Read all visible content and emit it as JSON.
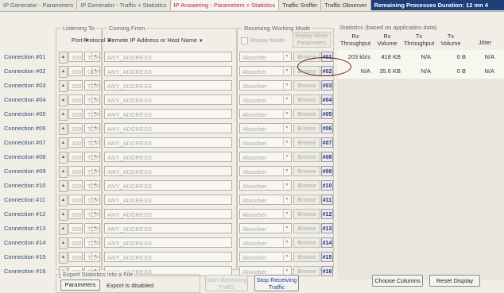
{
  "tabs": [
    {
      "label": "IP Generator - Parameters",
      "state": "normal"
    },
    {
      "label": "IP Generator - Traffic + Statistics",
      "state": "normal"
    },
    {
      "label": "IP Answering - Parameters + Statistics",
      "state": "active"
    },
    {
      "label": "Traffic Sniffer",
      "state": "plain"
    },
    {
      "label": "Traffic Observer",
      "state": "plain"
    }
  ],
  "remaining": "Remaining Processes Duration: 12 mn 4",
  "groups": {
    "listening": "Listening To",
    "coming_from": "Coming From",
    "receiving_mode": "Receiving Working Mode",
    "statistics": "Statistics (based on application data)",
    "export": "Export Statistics into a File"
  },
  "headers": {
    "port": "Port",
    "protocol": "Protocol",
    "remote": "Remote IP Address or Host Name",
    "replay_mode": "Replay Mode",
    "replay_params": [
      "Replay Mode",
      "Parameters"
    ],
    "rx_throughput": [
      "Rx",
      "Throughput"
    ],
    "rx_volume": [
      "Rx",
      "Volume"
    ],
    "tx_throughput": [
      "Tx",
      "Throughput"
    ],
    "tx_volume": [
      "Tx",
      "Volume"
    ],
    "jitter": "Jitter"
  },
  "connections": [
    {
      "label": "Connection #01",
      "port": "2009",
      "protocol": "TCP",
      "remote": "ANY_ADDRESS",
      "mode": "Absorber",
      "browse": "Browse",
      "num": "#01"
    },
    {
      "label": "Connection #02",
      "port": "2009",
      "protocol": "UDP",
      "remote": "ANY_ADDRESS",
      "mode": "Absorber",
      "browse": "Browse",
      "num": "#02"
    },
    {
      "label": "Connection #03",
      "port": "2009",
      "protocol": "TCP",
      "remote": "ANY_ADDRESS",
      "mode": "Absorber",
      "browse": "Browse",
      "num": "#03"
    },
    {
      "label": "Connection #04",
      "port": "2009",
      "protocol": "TCP",
      "remote": "ANY_ADDRESS",
      "mode": "Absorber",
      "browse": "Browse",
      "num": "#04"
    },
    {
      "label": "Connection #05",
      "port": "2009",
      "protocol": "TCP",
      "remote": "ANY_ADDRESS",
      "mode": "Absorber",
      "browse": "Browse",
      "num": "#05"
    },
    {
      "label": "Connection #06",
      "port": "2009",
      "protocol": "TCP",
      "remote": "ANY_ADDRESS",
      "mode": "Absorber",
      "browse": "Browse",
      "num": "#06"
    },
    {
      "label": "Connection #07",
      "port": "2009",
      "protocol": "TCP",
      "remote": "ANY_ADDRESS",
      "mode": "Absorber",
      "browse": "Browse",
      "num": "#07"
    },
    {
      "label": "Connection #08",
      "port": "2009",
      "protocol": "TCP",
      "remote": "ANY_ADDRESS",
      "mode": "Absorber",
      "browse": "Browse",
      "num": "#08"
    },
    {
      "label": "Connection #09",
      "port": "2009",
      "protocol": "TCP",
      "remote": "ANY_ADDRESS",
      "mode": "Absorber",
      "browse": "Browse",
      "num": "#09"
    },
    {
      "label": "Connection #10",
      "port": "2009",
      "protocol": "TCP",
      "remote": "ANY_ADDRESS",
      "mode": "Absorber",
      "browse": "Browse",
      "num": "#10"
    },
    {
      "label": "Connection #11",
      "port": "2009",
      "protocol": "TCP",
      "remote": "ANY_ADDRESS",
      "mode": "Absorber",
      "browse": "Browse",
      "num": "#11"
    },
    {
      "label": "Connection #12",
      "port": "2009",
      "protocol": "TCP",
      "remote": "ANY_ADDRESS",
      "mode": "Absorber",
      "browse": "Browse",
      "num": "#12"
    },
    {
      "label": "Connection #13",
      "port": "2009",
      "protocol": "TCP",
      "remote": "ANY_ADDRESS",
      "mode": "Absorber",
      "browse": "Browse",
      "num": "#13"
    },
    {
      "label": "Connection #14",
      "port": "2009",
      "protocol": "TCP",
      "remote": "ANY_ADDRESS",
      "mode": "Absorber",
      "browse": "Browse",
      "num": "#14"
    },
    {
      "label": "Connection #15",
      "port": "2009",
      "protocol": "TCP",
      "remote": "ANY_ADDRESS",
      "mode": "Absorber",
      "browse": "Browse",
      "num": "#15"
    },
    {
      "label": "Connection #16",
      "port": "2009",
      "protocol": "TCP",
      "remote": "ANY_ADDRESS",
      "mode": "Absorber",
      "browse": "Browse",
      "num": "#16"
    }
  ],
  "stats_rows": [
    {
      "rx_throughput": "203 kb/s",
      "rx_volume": "418 KB",
      "tx_throughput": "N/A",
      "tx_volume": "0 B",
      "jitter": "N/A"
    },
    {
      "rx_throughput": "N/A",
      "rx_volume": "35.6 KB",
      "tx_throughput": "N/A",
      "tx_volume": "0 B",
      "jitter": "N/A"
    }
  ],
  "footer": {
    "parameters_btn": "Parameters",
    "export_status": "Export is disabled",
    "start_btn": "Start Receiving Traffic",
    "stop_btn": "Stop Receiving Traffic",
    "choose_columns_btn": "Choose Columns",
    "reset_display_btn": "Reset Display"
  },
  "colors": {
    "accent_tab": "#c2185b",
    "remaining_bg": "#1f3f7a",
    "highlight_ellipse": "#7a1a1a"
  }
}
